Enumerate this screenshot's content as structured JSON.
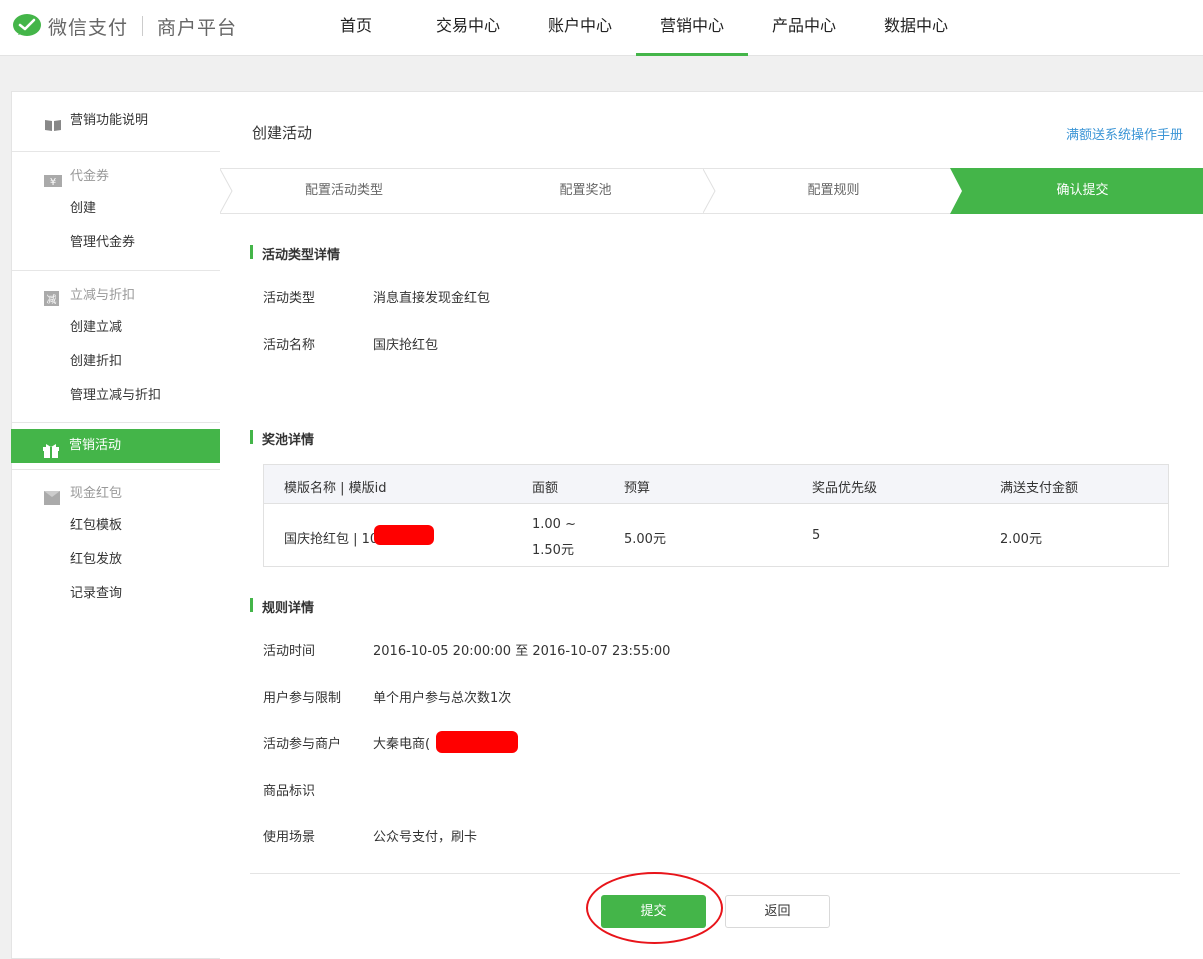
{
  "brand": {
    "name": "微信支付",
    "sub": "商户平台",
    "logo_icon": "wechat-pay-logo-icon",
    "accent": "#44b549"
  },
  "topnav": [
    {
      "label": "首页"
    },
    {
      "label": "交易中心"
    },
    {
      "label": "账户中心"
    },
    {
      "label": "营销中心",
      "active": true
    },
    {
      "label": "产品中心"
    },
    {
      "label": "数据中心"
    }
  ],
  "sidebar": {
    "intro": {
      "label": "营销功能说明",
      "icon": "book-icon"
    },
    "voucher": {
      "label": "代金券",
      "icon": "yen-icon",
      "items": [
        "创建",
        "管理代金券"
      ]
    },
    "discount": {
      "label": "立减与折扣",
      "icon": "discount-icon",
      "items": [
        "创建立减",
        "创建折扣",
        "管理立减与折扣"
      ]
    },
    "activity": {
      "label": "营销活动",
      "icon": "gift-icon",
      "active": true
    },
    "redpack": {
      "label": "现金红包",
      "icon": "envelope-icon",
      "items": [
        "红包模板",
        "红包发放",
        "记录查询"
      ]
    }
  },
  "main": {
    "title": "创建活动",
    "manual_link": "满额送系统操作手册",
    "steps": [
      "配置活动类型",
      "配置奖池",
      "配置规则",
      "确认提交"
    ],
    "active_step": 3,
    "activity_section": {
      "title": "活动类型详情",
      "type_label": "活动类型",
      "type_value": "消息直接发现金红包",
      "name_label": "活动名称",
      "name_value": "国庆抢红包"
    },
    "pool_section": {
      "title": "奖池详情",
      "headers": {
        "template": "模版名称 | 模版id",
        "amount": "面额",
        "budget": "预算",
        "priority": "奖品优先级",
        "threshold": "满送支付金额"
      },
      "row": {
        "template": "国庆抢红包 | 10",
        "amount_line1": "1.00 ~",
        "amount_line2": "1.50元",
        "budget": "5.00元",
        "priority": "5",
        "threshold": "2.00元"
      }
    },
    "rule_section": {
      "title": "规则详情",
      "time_label": "活动时间",
      "time_value": "2016-10-05 20:00:00 至 2016-10-07 23:55:00",
      "limit_label": "用户参与限制",
      "limit_value": "单个用户参与总次数1次",
      "merchant_label": "活动参与商户",
      "merchant_value": "大秦电商(",
      "goods_label": "商品标识",
      "goods_value": "",
      "scene_label": "使用场景",
      "scene_value": "公众号支付，刷卡"
    },
    "buttons": {
      "submit": "提交",
      "back": "返回"
    }
  }
}
